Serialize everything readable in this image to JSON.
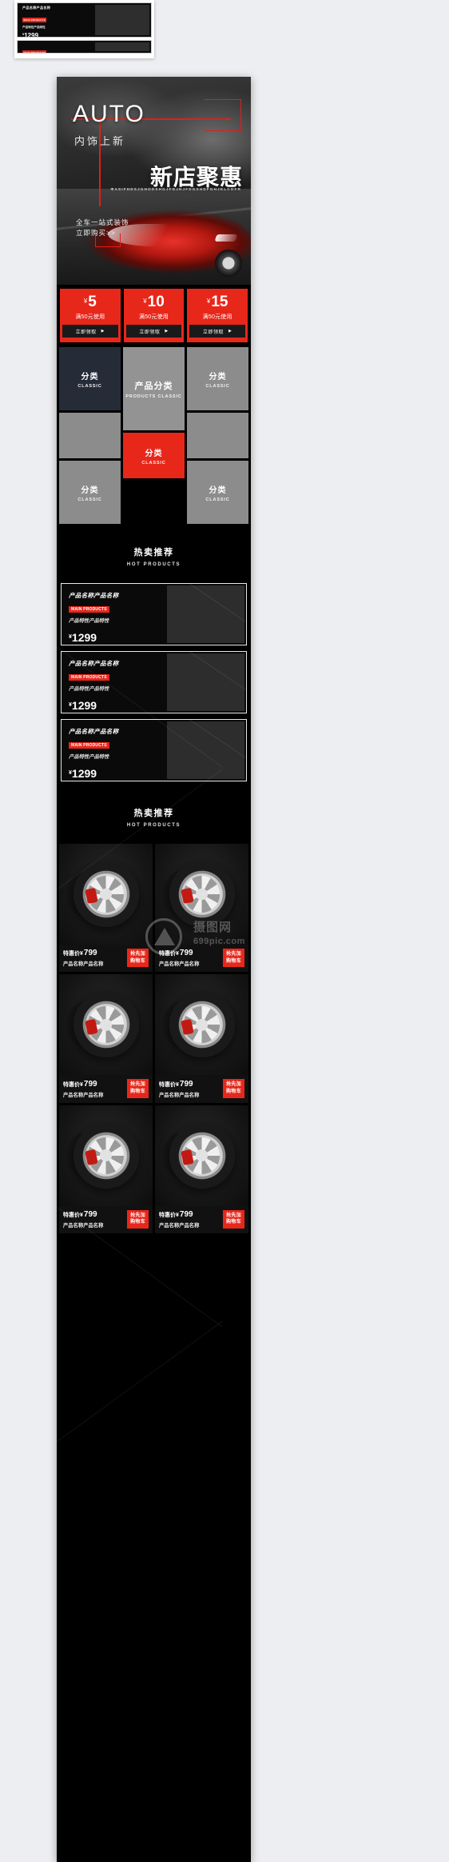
{
  "preview": {
    "title": "产品名称产品名称",
    "badge": "MAIN PRODUCTS",
    "feature": "产品特性产品特性",
    "currency": "¥",
    "price": "1299"
  },
  "banner": {
    "brand": "AUTO",
    "subtitle": "内饰上新",
    "headline": "新店聚惠",
    "eng_line": "ΦASIFHDSJGHODSHGJFDJHJFDGSHDFGHJKLCDFR",
    "tagline1": "全车一站式装饰",
    "tagline2": "立即购买>>",
    "accent_color": "#e01f19"
  },
  "coupons": [
    {
      "currency": "¥",
      "amount": "5",
      "condition": "满50元使用",
      "button": "立即领取",
      "arrow": "▶"
    },
    {
      "currency": "¥",
      "amount": "10",
      "condition": "满50元使用",
      "button": "立即领取",
      "arrow": "▶"
    },
    {
      "currency": "¥",
      "amount": "15",
      "condition": "满50元使用",
      "button": "立即领取",
      "arrow": "▶"
    }
  ],
  "categories": {
    "top_left": {
      "cn": "分类",
      "en": "CLASSIC",
      "color": "#262b38"
    },
    "center": {
      "cn": "产品分类",
      "en": "PRODUCTS CLASSIC",
      "color": "#939393"
    },
    "top_right": {
      "cn": "分类",
      "en": "CLASSIC",
      "color": "#8c8c8c"
    },
    "mid_left": {
      "cn": "",
      "en": "",
      "color": "#8c8c8c"
    },
    "mid_right": {
      "cn": "",
      "en": "",
      "color": "#8c8c8c"
    },
    "bottom_left": {
      "cn": "分类",
      "en": "CLASSIC",
      "color": "#8c8c8c"
    },
    "bottom_center": {
      "cn": "分类",
      "en": "CLASSIC",
      "color": "#e8271b"
    },
    "bottom_right": {
      "cn": "分类",
      "en": "CLASSIC",
      "color": "#8c8c8c"
    }
  },
  "section1": {
    "cn": "热卖推荐",
    "en": "HOT PRODUCTS"
  },
  "section2": {
    "cn": "热卖推荐",
    "en": "HOT PRODUCTS"
  },
  "products": [
    {
      "title": "产品名称产品名称",
      "badge": "MAIN PRODUCTS",
      "feature": "产品特性产品特性",
      "currency": "¥",
      "price": "1299"
    },
    {
      "title": "产品名称产品名称",
      "badge": "MAIN PRODUCTS",
      "feature": "产品特性产品特性",
      "currency": "¥",
      "price": "1299"
    },
    {
      "title": "产品名称产品名称",
      "badge": "MAIN PRODUCTS",
      "feature": "产品特性产品特性",
      "currency": "¥",
      "price": "1299"
    }
  ],
  "wheels": [
    {
      "price_label": "特惠价¥",
      "price": "799",
      "name": "产品名称产品名称",
      "button": "抢先加\n购物车"
    },
    {
      "price_label": "特惠价¥",
      "price": "799",
      "name": "产品名称产品名称",
      "button": "抢先加\n购物车"
    },
    {
      "price_label": "特惠价¥",
      "price": "799",
      "name": "产品名称产品名称",
      "button": "抢先加\n购物车"
    },
    {
      "price_label": "特惠价¥",
      "price": "799",
      "name": "产品名称产品名称",
      "button": "抢先加\n购物车"
    },
    {
      "price_label": "特惠价¥",
      "price": "799",
      "name": "产品名称产品名称",
      "button": "抢先加\n购物车"
    },
    {
      "price_label": "特惠价¥",
      "price": "799",
      "name": "产品名称产品名称",
      "button": "抢先加\n购物车"
    }
  ],
  "watermark": {
    "top": "摄图网",
    "bottom": "699pic.com"
  }
}
